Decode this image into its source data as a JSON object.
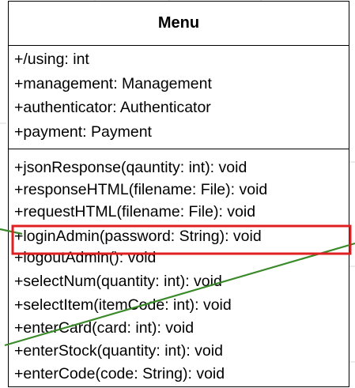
{
  "uml": {
    "class_name": "Menu",
    "attributes": [
      "+/using: int",
      "+management: Management",
      "+authenticator: Authenticator",
      "+payment: Payment"
    ],
    "methods": [
      "+jsonResponse(qauntity: int): void",
      "+responseHTML(filename: File): void",
      "+requestHTML(filename: File): void",
      "+loginAdmin(password: String): void",
      "+logoutAdmin(): void",
      "+selectNum(quantity: int): void",
      "+selectItem(itemCode: int): void",
      "+enterCard(card: int): void",
      "+enterStock(quantity: int): void",
      "+enterCode(code: String): void"
    ]
  },
  "annotations": {
    "highlight_color": "#e02020",
    "connector_color": "#3a8a2a",
    "highlighted_method": "+loginAdmin(password: String): void"
  }
}
